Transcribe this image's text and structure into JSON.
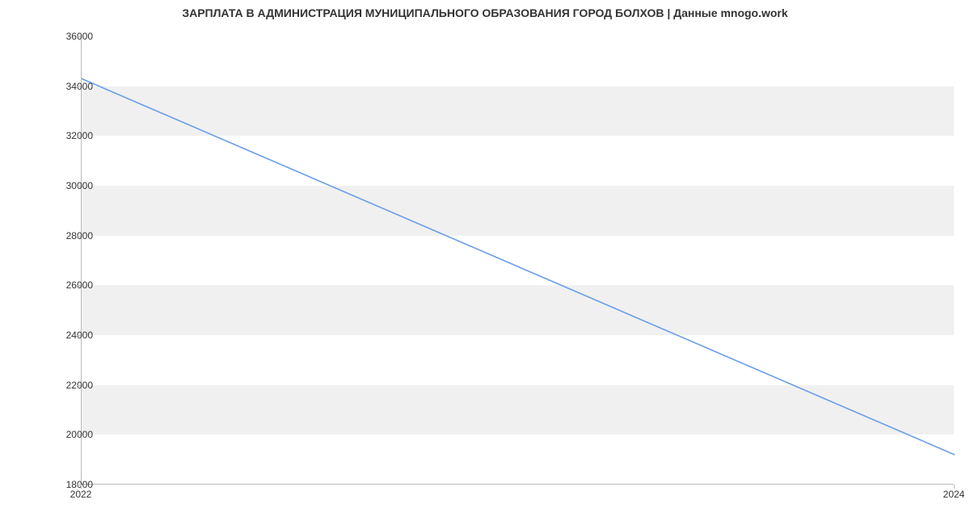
{
  "chart_data": {
    "type": "line",
    "title": "ЗАРПЛАТА В АДМИНИСТРАЦИЯ МУНИЦИПАЛЬНОГО ОБРАЗОВАНИЯ ГОРОД БОЛХОВ | Данные mnogo.work",
    "xlabel": "",
    "ylabel": "",
    "x": [
      2022,
      2024
    ],
    "values": [
      34300,
      19200
    ],
    "y_ticks": [
      18000,
      20000,
      22000,
      24000,
      26000,
      28000,
      30000,
      32000,
      34000,
      36000
    ],
    "x_ticks": [
      2022,
      2024
    ],
    "xlim": [
      2022,
      2024
    ],
    "ylim": [
      18000,
      36000
    ],
    "line_color": "#6a9ee8",
    "band_color": "#f0f0f0"
  }
}
